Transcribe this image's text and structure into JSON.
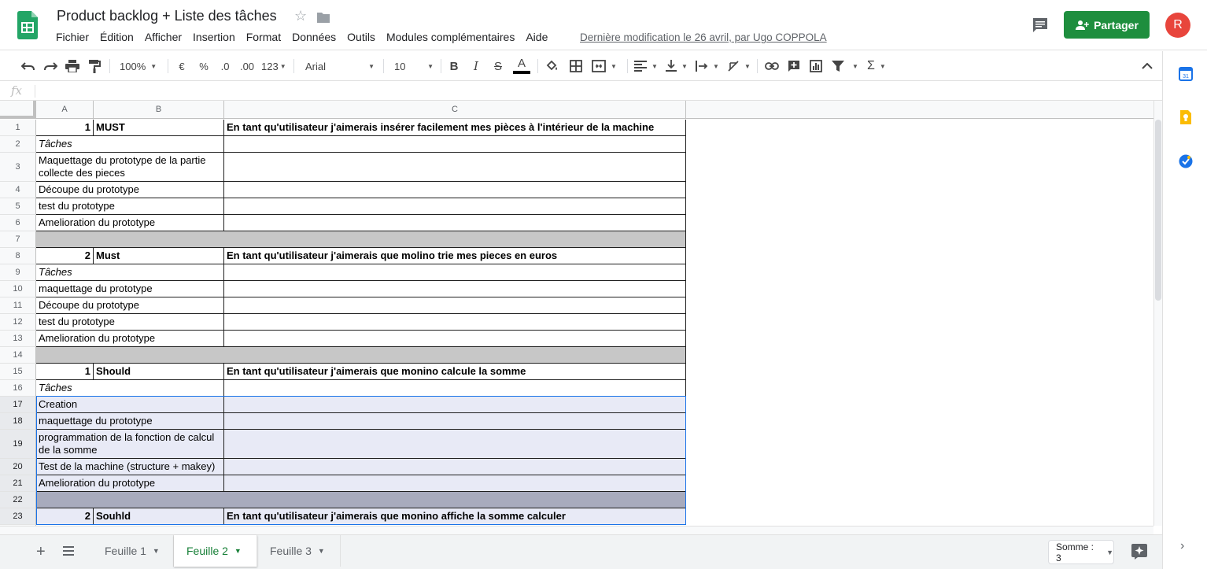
{
  "header": {
    "title": "Product backlog + Liste des tâches",
    "menus": [
      "Fichier",
      "Édition",
      "Afficher",
      "Insertion",
      "Format",
      "Données",
      "Outils",
      "Modules complémentaires",
      "Aide"
    ],
    "last_edit": "Dernière modification le 26 avril, par Ugo COPPOLA",
    "share_label": "Partager",
    "avatar_letter": "R"
  },
  "toolbar": {
    "zoom": "100%",
    "currency": "€",
    "percent": "%",
    "dec_decrease": ".0",
    "dec_increase": ".00",
    "more_formats": "123",
    "font": "Arial",
    "font_size": "10"
  },
  "columns": [
    "A",
    "B",
    "C"
  ],
  "rows": [
    {
      "n": "1",
      "a": "1",
      "b": "MUST",
      "c": "En tant qu'utilisateur j'aimerais insérer facilement mes pièces à l'intérieur de la machine",
      "type": "story"
    },
    {
      "n": "2",
      "ab": "Tâches",
      "c": "",
      "type": "label"
    },
    {
      "n": "3",
      "ab": "Maquettage du prototype de la partie collecte des pieces",
      "c": "",
      "type": "task",
      "tall": true
    },
    {
      "n": "4",
      "ab": "Découpe du prototype",
      "c": "",
      "type": "task"
    },
    {
      "n": "5",
      "ab": "test du prototype",
      "c": "",
      "type": "task"
    },
    {
      "n": "6",
      "ab": "Amelioration du prototype",
      "c": "",
      "type": "task"
    },
    {
      "n": "7",
      "type": "sep"
    },
    {
      "n": "8",
      "a": "2",
      "b": "Must",
      "c": "En tant qu'utilisateur j'aimerais que molino trie mes pieces en euros",
      "type": "story"
    },
    {
      "n": "9",
      "ab": "Tâches",
      "c": "",
      "type": "label"
    },
    {
      "n": "10",
      "ab": "maquettage du prototype",
      "c": "",
      "type": "task"
    },
    {
      "n": "11",
      "ab": "Découpe du prototype",
      "c": "",
      "type": "task"
    },
    {
      "n": "12",
      "ab": "test du prototype",
      "c": "",
      "type": "task"
    },
    {
      "n": "13",
      "ab": "Amelioration du prototype",
      "c": "",
      "type": "task"
    },
    {
      "n": "14",
      "type": "sep"
    },
    {
      "n": "15",
      "a": "1",
      "b": "Should",
      "c": "En tant qu'utilisateur j'aimerais que monino calcule la somme",
      "type": "story"
    },
    {
      "n": "16",
      "ab": "Tâches",
      "c": "",
      "type": "label"
    },
    {
      "n": "17",
      "ab": "Creation",
      "c": "",
      "type": "task",
      "sel": true
    },
    {
      "n": "18",
      "ab": "maquettage du prototype",
      "c": "",
      "type": "task",
      "sel": true
    },
    {
      "n": "19",
      "ab": "programmation de la fonction de calcul de la somme",
      "c": "",
      "type": "task",
      "tall": true,
      "sel": true
    },
    {
      "n": "20",
      "ab": "Test de la machine (structure + makey)",
      "c": "",
      "type": "task",
      "sel": true
    },
    {
      "n": "21",
      "ab": "Amelioration du prototype",
      "c": "",
      "type": "task",
      "sel": true
    },
    {
      "n": "22",
      "type": "sep",
      "sel": true
    },
    {
      "n": "23",
      "a": "2",
      "b": "Souhld",
      "c": "En tant qu'utilisateur j'aimerais que monino affiche la somme calculer",
      "type": "story",
      "sel": true
    }
  ],
  "sheets": {
    "tabs": [
      "Feuille 1",
      "Feuille 2",
      "Feuille 3"
    ],
    "active": "Feuille 2",
    "sum": "Somme : 3"
  },
  "colors": {
    "brand_green": "#1e8e3e",
    "avatar": "#e8453c",
    "selection": "#1a73e8",
    "separator_gray": "#c7c7c7"
  }
}
